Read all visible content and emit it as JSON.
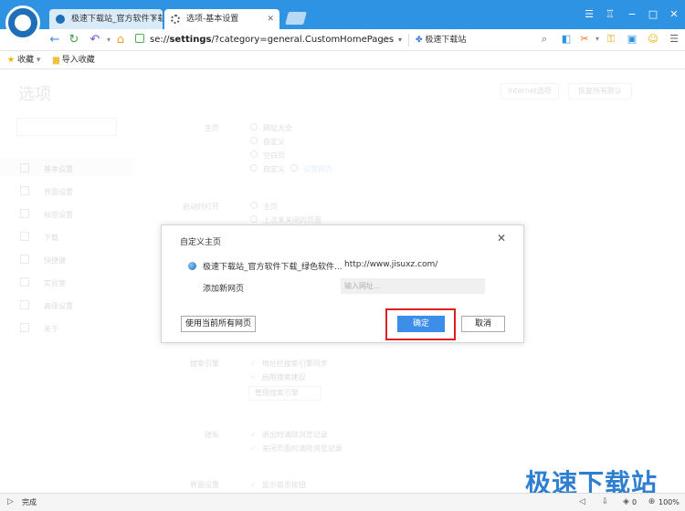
{
  "browser": {
    "tabs": [
      {
        "label": "极速下载站_官方软件下载",
        "close": "✕"
      },
      {
        "label": "选项-基本设置",
        "close": "✕"
      }
    ],
    "address": {
      "url_prefix": "se://",
      "url_bold": "settings",
      "url_rest": "/?category=general.CustomHomePages",
      "site_name": "极速下载站"
    },
    "bookmarks": [
      {
        "label": "收藏",
        "icon": "star-icon"
      },
      {
        "label": "导入收藏",
        "icon": "folder-icon"
      }
    ],
    "status": {
      "text": "完成",
      "zoom": "100%",
      "count": "0"
    }
  },
  "settings_page": {
    "title": "选项",
    "top_buttons": [
      "Internet选项",
      "恢复所有默认"
    ],
    "sidebar": [
      "基本设置",
      "界面设置",
      "标签设置",
      "下载",
      "快捷键",
      "实验室",
      "高级设置",
      "关于"
    ],
    "sections": {
      "homepage": {
        "label": "主页",
        "options": [
          "网址大全",
          "自定义",
          "空白页",
          "自定义"
        ],
        "link": "设置网页"
      },
      "startup": {
        "label": "启动时打开",
        "options": [
          "主页",
          "上次未关闭的页面"
        ]
      },
      "search": {
        "label": "搜索引擎",
        "checks": [
          "地址栏搜索引擎同步",
          "启用搜索建议"
        ],
        "dropdown": "管理搜索引擎"
      },
      "tracking": {
        "label": "隐私",
        "checks": [
          "退出时清除浏览记录",
          "关闭页面时清除浏览记录"
        ]
      },
      "ui": {
        "label": "界面设置",
        "checks": [
          "显示首页按钮"
        ]
      }
    }
  },
  "dialog": {
    "title": "自定义主页",
    "close": "✕",
    "site_name": "极速下载站_官方软件下载_绿色软件...",
    "site_url": "http://www.jisuxz.com/",
    "add_label": "添加新网页",
    "input_placeholder": "输入网址...",
    "use_all_label": "使用当前所有网页",
    "ok_label": "确定",
    "cancel_label": "取消",
    "highlight_color": "#e02020"
  },
  "watermark": "极速下载站"
}
